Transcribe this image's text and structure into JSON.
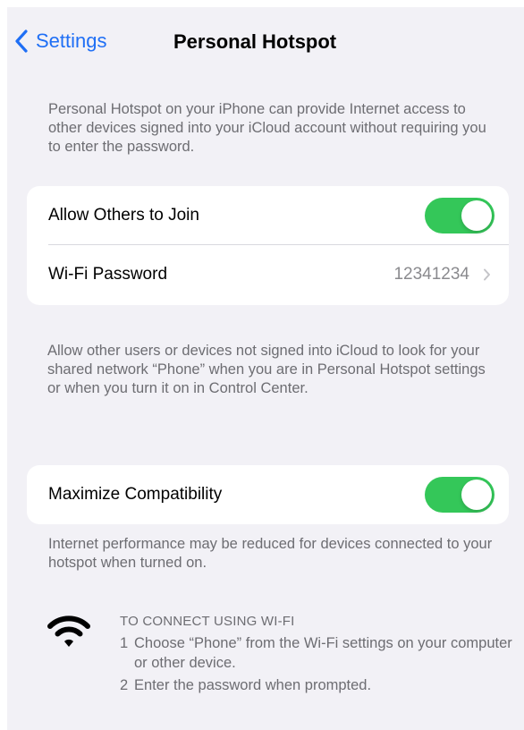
{
  "nav": {
    "back_label": "Settings",
    "title": "Personal Hotspot"
  },
  "intro_text": "Personal Hotspot on your iPhone can provide Internet access to other devices signed into your iCloud account without requiring you to enter the password.",
  "group1": {
    "allow_others": {
      "label": "Allow Others to Join",
      "enabled": true
    },
    "wifi_password": {
      "label": "Wi-Fi Password",
      "value": "12341234"
    }
  },
  "allow_footer": "Allow other users or devices not signed into iCloud to look for your shared network “Phone” when you are in Personal Hotspot settings or when you turn it on in Control Center.",
  "group2": {
    "maximize_compatibility": {
      "label": "Maximize Compatibility",
      "enabled": true
    }
  },
  "performance_footer": "Internet performance may be reduced for devices connected to your hotspot when turned on.",
  "connect": {
    "icon": "wifi-icon",
    "heading": "TO CONNECT USING WI-FI",
    "steps": [
      {
        "num": "1",
        "text": "Choose “Phone” from the Wi-Fi settings on your computer or other device."
      },
      {
        "num": "2",
        "text": "Enter the password when prompted."
      }
    ]
  },
  "colors": {
    "accent": "#1f6ff5",
    "toggle_on": "#34c759",
    "background": "#f2f1f6",
    "secondary_text": "#6d6d72"
  }
}
